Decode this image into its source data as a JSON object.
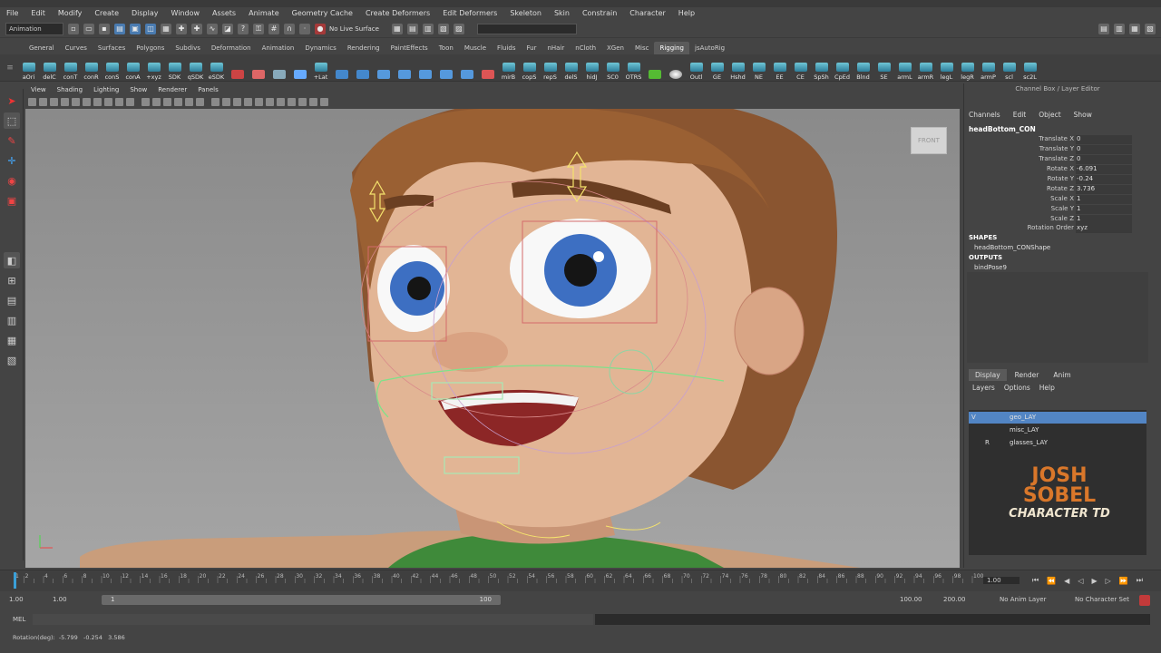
{
  "menu_bar": [
    "File",
    "Edit",
    "Modify",
    "Create",
    "Display",
    "Window",
    "Assets",
    "Animate",
    "Geometry Cache",
    "Create Deformers",
    "Edit Deformers",
    "Skeleton",
    "Skin",
    "Constrain",
    "Character",
    "Help"
  ],
  "status_line": {
    "mode": "Animation",
    "live_surface": "No Live Surface"
  },
  "shelf_tabs": [
    "General",
    "Curves",
    "Surfaces",
    "Polygons",
    "Subdivs",
    "Deformation",
    "Animation",
    "Dynamics",
    "Rendering",
    "PaintEffects",
    "Toon",
    "Muscle",
    "Fluids",
    "Fur",
    "nHair",
    "nCloth",
    "XGen",
    "Misc",
    "Rigging",
    "jsAutoRig"
  ],
  "active_shelf": "Rigging",
  "shelf_buttons": [
    "aOri",
    "delC",
    "conT",
    "conR",
    "conS",
    "conA",
    "+xyz",
    "SDK",
    "qSDK",
    "eSDK",
    "",
    "",
    "",
    "",
    "+Lat",
    "",
    "",
    "",
    "",
    "",
    "",
    "",
    "",
    "mirB",
    "copS",
    "repS",
    "delS",
    "hidJ",
    "SC0",
    "OTRS",
    "",
    "",
    "Outl",
    "GE",
    "Hshd",
    "NE",
    "EE",
    "CE",
    "SpSh",
    "CpEd",
    "Blnd",
    "SE",
    "armL",
    "armR",
    "legL",
    "legR",
    "armP",
    "scl",
    "sc2L"
  ],
  "viewport": {
    "menu": [
      "View",
      "Shading",
      "Lighting",
      "Show",
      "Renderer",
      "Panels"
    ],
    "viewcube": "FRONT"
  },
  "channel_box": {
    "title": "Channel Box / Layer Editor",
    "menu": [
      "Channels",
      "Edit",
      "Object",
      "Show"
    ],
    "object": "headBottom_CON",
    "attributes": [
      {
        "name": "Translate X",
        "value": "0"
      },
      {
        "name": "Translate Y",
        "value": "0"
      },
      {
        "name": "Translate Z",
        "value": "0"
      },
      {
        "name": "Rotate X",
        "value": "-6.091"
      },
      {
        "name": "Rotate Y",
        "value": "-0.24"
      },
      {
        "name": "Rotate Z",
        "value": "3.736"
      },
      {
        "name": "Scale X",
        "value": "1"
      },
      {
        "name": "Scale Y",
        "value": "1"
      },
      {
        "name": "Scale Z",
        "value": "1"
      },
      {
        "name": "Rotation Order",
        "value": "xyz"
      }
    ],
    "shapes_label": "SHAPES",
    "shape": "headBottom_CONShape",
    "outputs_label": "OUTPUTS",
    "output": "bindPose9"
  },
  "layer_editor": {
    "tabs": [
      "Display",
      "Render",
      "Anim"
    ],
    "active_tab": "Display",
    "menu": [
      "Layers",
      "Options",
      "Help"
    ],
    "layers": [
      {
        "v": "V",
        "t": "",
        "name": "geo_LAY",
        "selected": true
      },
      {
        "v": "",
        "t": "",
        "name": "misc_LAY",
        "selected": false
      },
      {
        "v": "",
        "t": "R",
        "name": "glasses_LAY",
        "selected": false
      }
    ]
  },
  "logo": {
    "line1": "JOSH",
    "line2": "SOBEL",
    "line3": "CHARACTER TD"
  },
  "timeline": {
    "ticks": [
      "1",
      "2",
      "4",
      "6",
      "8",
      "10",
      "12",
      "14",
      "16",
      "18",
      "20",
      "22",
      "24",
      "26",
      "28",
      "30",
      "32",
      "34",
      "36",
      "38",
      "40",
      "42",
      "44",
      "46",
      "48",
      "50",
      "52",
      "54",
      "56",
      "58",
      "60",
      "62",
      "64",
      "66",
      "68",
      "70",
      "72",
      "74",
      "76",
      "78",
      "80",
      "82",
      "84",
      "86",
      "88",
      "90",
      "92",
      "94",
      "96",
      "98",
      "100"
    ],
    "current_frame": "1.00"
  },
  "range_slider": {
    "start": "1.00",
    "start_inner": "1.00",
    "slider_start": "1",
    "slider_end": "100",
    "end_inner": "100.00",
    "end": "200.00",
    "anim_layer": "No Anim Layer",
    "char_set": "No Character Set"
  },
  "command_line": {
    "label": "MEL"
  },
  "help_line": {
    "text": "Rotation(deg):  -5.799   -0.254   3.586"
  },
  "colors": {
    "ui_bg": "#444444",
    "viewport_bg": "#9a9a9a",
    "selected_layer": "#5285c4",
    "accent_red": "#c23a3a"
  }
}
